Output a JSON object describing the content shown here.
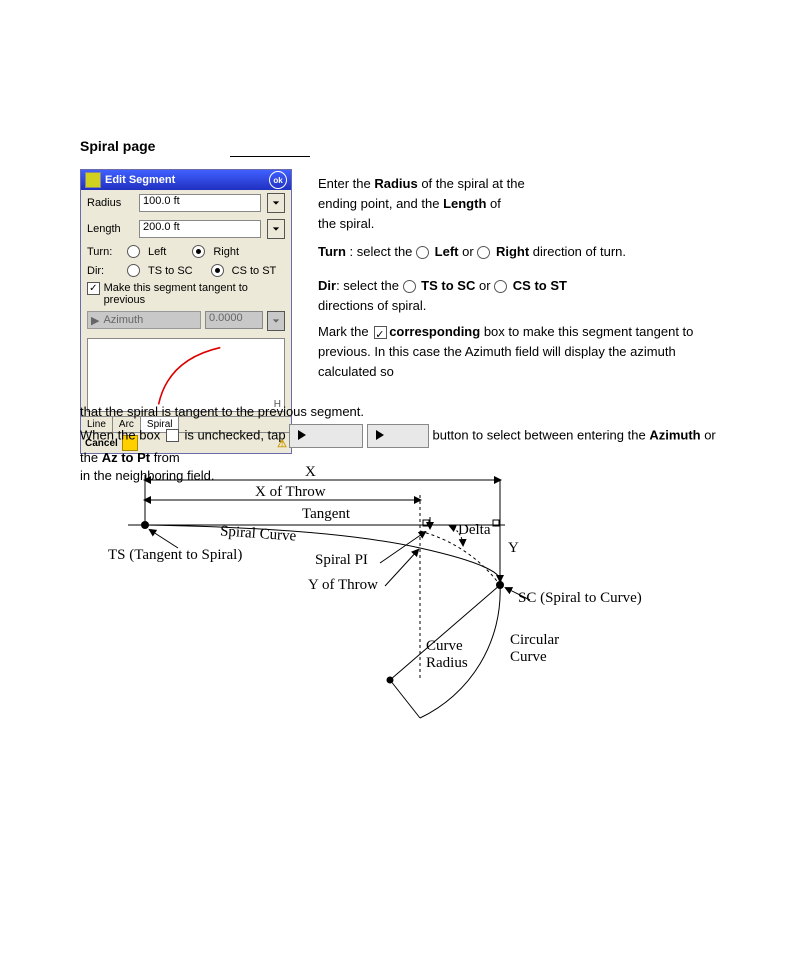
{
  "section": {
    "title": "Spiral page"
  },
  "dialog": {
    "title": "Edit Segment",
    "ok": "ok",
    "radius_label": "Radius",
    "radius_value": "100.0 ft",
    "length_label": "Length",
    "length_value": "200.0 ft",
    "turn_label": "Turn:",
    "left": "Left",
    "right": "Right",
    "dir_label": "Dir:",
    "ts_to_sc": "TS to SC",
    "cs_to_st": "CS to ST",
    "tangent_check": "Make this segment tangent to previous",
    "azimuth_btn": "Azimuth",
    "azimuth_val": "0.0000",
    "preview_letter": "H",
    "tabs": [
      "Line",
      "Arc",
      "Spiral"
    ],
    "cancel": "Cancel",
    "warn_icon": "⚠"
  },
  "desc": {
    "p1_a": "Enter the ",
    "p1_b": " of the spiral at the",
    "p1_c": "ending point, and the ",
    "p1_d": " of",
    "p1_e": "the spiral.",
    "p2_a": " select the ",
    "p2_b": "or",
    "p2_c": " direction of turn.",
    "p3_a": ": select the ",
    "p3_b": "directions of spiral.",
    "p4_a": "Mark the ",
    "p4_b": " box ",
    "p4_c": "to make this segment tangent to previous. In this case the Azimuth field will display the azimuth calculated so",
    "p4_d": "that the spiral is tangent to the previous segment.",
    "p5_a": "When the box ",
    "p5_b": " is unchecked, tap  ",
    "p5_c": "button to select between entering the ",
    "p5_d": " or the ",
    "p5_e": " from ",
    "p5_f": "in the neighboring field."
  },
  "terms": {
    "radius": "Radius",
    "length": "Length",
    "turn": "Turn",
    "left": "Left",
    "right": "Right",
    "dir": "Dir",
    "ts_sc": "TS to SC",
    "cs_st": "CS to ST",
    "corresponding": "corresponding",
    "azimuth": "Azimuth",
    "az_pt": "Az to Pt"
  },
  "diagram": {
    "x": "X",
    "x_throw": "X of Throw",
    "tangent": "Tangent",
    "ts": "TS (Tangent to Spiral)",
    "spiral_curve": "Spiral Curve",
    "spiral_pi": "Spiral PI",
    "y_throw": "Y of Throw",
    "delta": "Delta",
    "y": "Y",
    "sc": "SC (Spiral to Curve)",
    "curve_radius": "Curve\nRadius",
    "circular_curve": "Circular\nCurve"
  }
}
